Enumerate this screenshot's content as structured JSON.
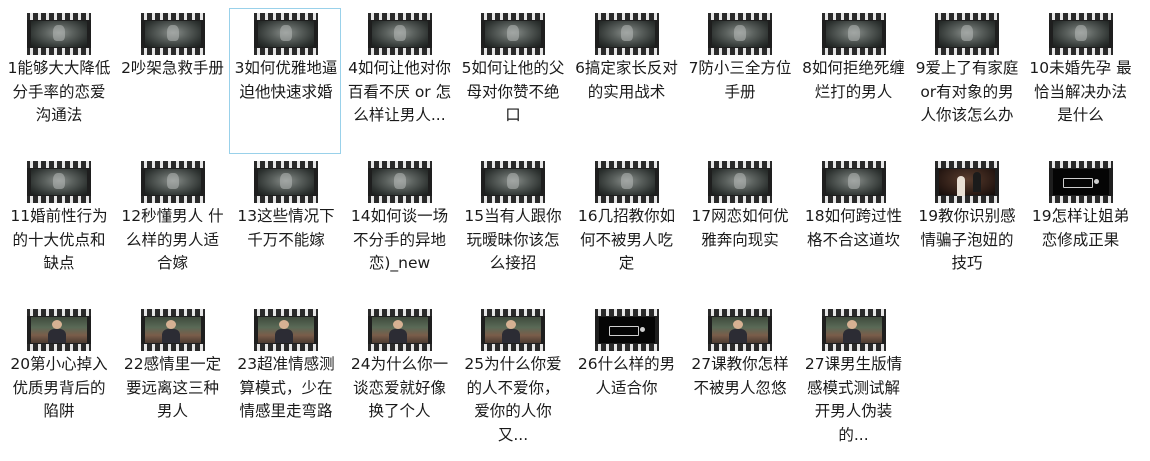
{
  "files": [
    {
      "name": "1能够大大降低分手率的恋爱沟通法",
      "thumb": "dark"
    },
    {
      "name": "2吵架急救手册",
      "thumb": "dark"
    },
    {
      "name": "3如何优雅地逼迫他快速求婚",
      "thumb": "dark",
      "selected": true
    },
    {
      "name": "4如何让他对你百看不厌 or 怎么样让男人...",
      "thumb": "dark"
    },
    {
      "name": "5如何让他的父母对你赞不绝口",
      "thumb": "dark"
    },
    {
      "name": "6搞定家长反对的实用战术",
      "thumb": "dark"
    },
    {
      "name": "7防小三全方位手册",
      "thumb": "dark"
    },
    {
      "name": "8如何拒绝死缠烂打的男人",
      "thumb": "dark"
    },
    {
      "name": "9爱上了有家庭or有对象的男人你该怎么办",
      "thumb": "dark"
    },
    {
      "name": "10未婚先孕 最恰当解决办法是什么",
      "thumb": "dark"
    },
    {
      "name": "11婚前性行为的十大优点和缺点",
      "thumb": "dark"
    },
    {
      "name": "12秒懂男人 什么样的男人适合嫁",
      "thumb": "dark"
    },
    {
      "name": "13这些情况下千万不能嫁",
      "thumb": "dark"
    },
    {
      "name": "14如何谈一场不分手的异地恋)_new",
      "thumb": "dark"
    },
    {
      "name": "15当有人跟你玩暧昧你该怎么接招",
      "thumb": "dark"
    },
    {
      "name": "16几招教你如何不被男人吃定",
      "thumb": "dark"
    },
    {
      "name": "17网恋如何优雅奔向现实",
      "thumb": "dark"
    },
    {
      "name": "18如何跨过性格不合这道坎",
      "thumb": "dark"
    },
    {
      "name": "19教你识别感情骗子泡妞的技巧",
      "thumb": "stage"
    },
    {
      "name": "19怎样让姐弟恋修成正果",
      "thumb": "logo"
    },
    {
      "name": "20第小心掉入优质男背后的陷阱",
      "thumb": "room"
    },
    {
      "name": "22感情里一定要远离这三种男人",
      "thumb": "room"
    },
    {
      "name": "23超准情感测算模式，少在情感里走弯路",
      "thumb": "room"
    },
    {
      "name": "24为什么你一谈恋爱就好像换了个人",
      "thumb": "room"
    },
    {
      "name": "25为什么你爱的人不爱你，爱你的人你又...",
      "thumb": "room"
    },
    {
      "name": "26什么样的男人适合你",
      "thumb": "logo"
    },
    {
      "name": "27课教你怎样不被男人忽悠",
      "thumb": "room"
    },
    {
      "name": "27课男生版情感模式测试解开男人伪装的...",
      "thumb": "room"
    }
  ]
}
